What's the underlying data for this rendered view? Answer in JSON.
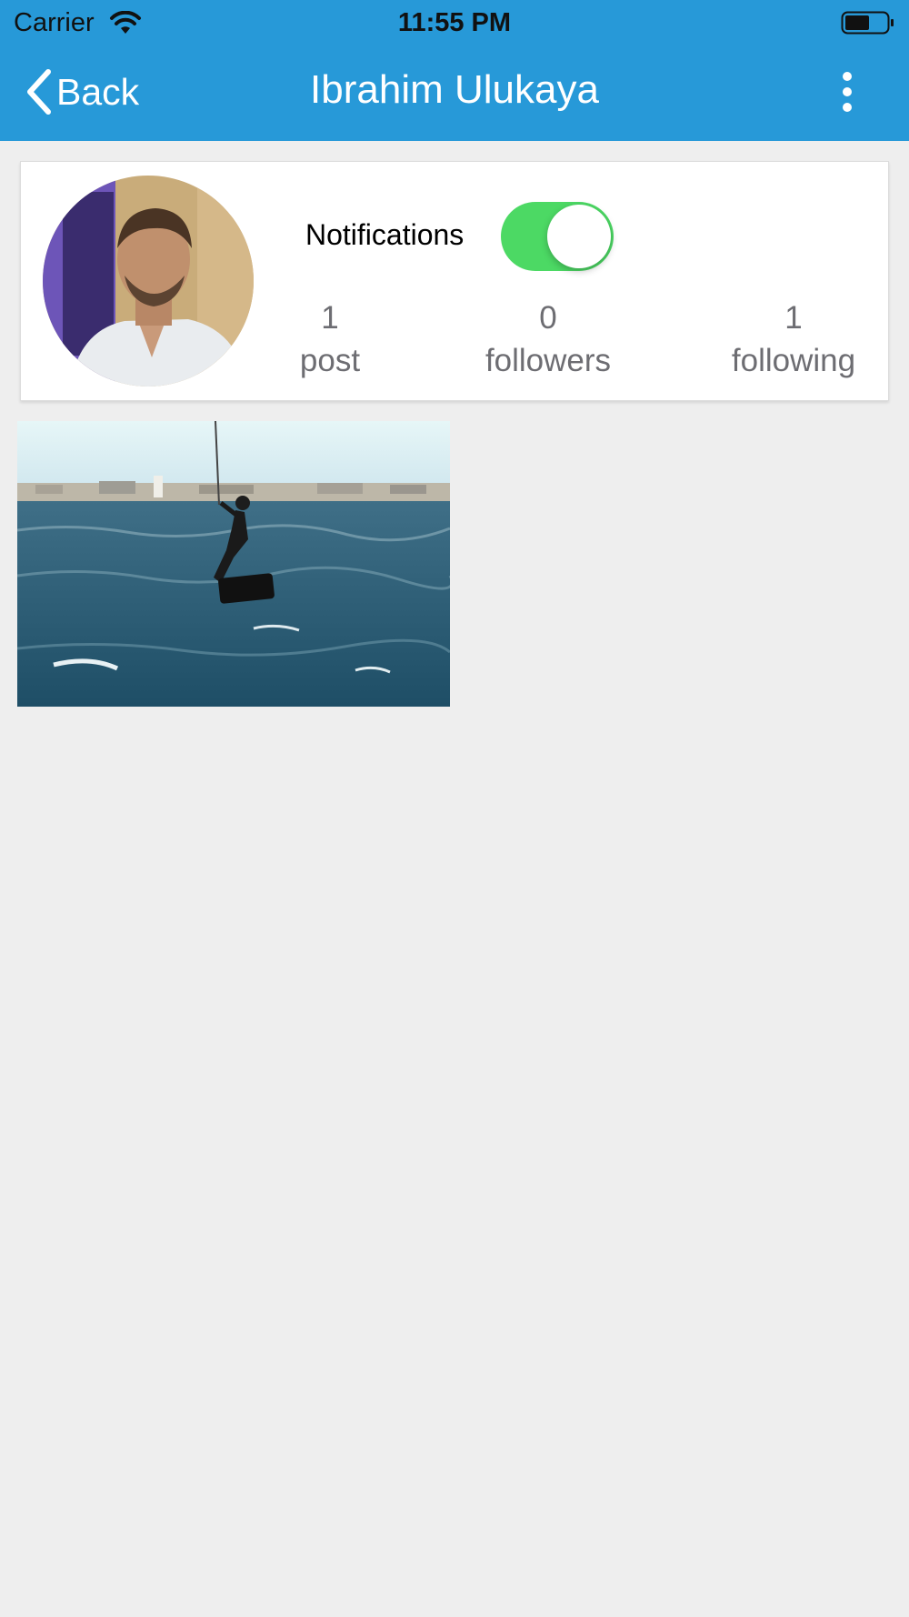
{
  "status_bar": {
    "carrier": "Carrier",
    "time": "11:55 PM"
  },
  "nav": {
    "back_label": "Back",
    "title": "Ibrahim Ulukaya"
  },
  "profile": {
    "notifications_label": "Notifications",
    "notifications_enabled": true,
    "stats": {
      "posts": {
        "count": "1",
        "label": "post"
      },
      "followers": {
        "count": "0",
        "label": "followers"
      },
      "following": {
        "count": "1",
        "label": "following"
      }
    }
  },
  "colors": {
    "primary": "#2799d8",
    "toggle_on": "#4cd964",
    "background": "#eeeeee",
    "stat_text": "#6d6d72"
  },
  "icons": [
    "wifi-icon",
    "battery-icon",
    "chevron-left-icon",
    "more-vertical-icon"
  ]
}
